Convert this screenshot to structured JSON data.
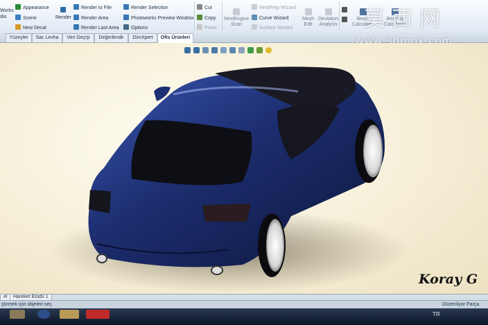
{
  "ribbon": {
    "col1": [
      "Works",
      "dio"
    ],
    "appearance": "Appearance",
    "scene": "Scene",
    "new_decal": "New Decal",
    "render": "Render",
    "render_to_file": "Render to File",
    "render_area": "Render Area",
    "render_last_area": "Render Last Area",
    "render_selection": "Render Selection",
    "photoworks_preview_window": "Photoworks Preview Window",
    "options": "Options",
    "cut": "Cut",
    "copy": "Copy",
    "paste": "Paste",
    "nextengine_scan": [
      "NextEngine",
      "Scan"
    ],
    "nextprep_wizard": "NextPrep Wizard",
    "curve_wizard": "Curve Wizard",
    "surface_wizard": "Surface Wizard",
    "mesh_edit": [
      "Mesh",
      "Edit"
    ],
    "deviation_analysis": [
      "Deviation",
      "Analysis"
    ],
    "beam_calculator": [
      "Beam",
      "Calculator"
    ],
    "bearing_calculator": [
      "Bearing",
      "Calculator"
    ]
  },
  "tabs": [
    "Yüzeyler",
    "Sac Levha",
    "Veri Geçişi",
    "Değerlendir",
    "DimXpert",
    "Ofis Ürünleri"
  ],
  "active_tab": "Ofis Ürünleri",
  "watermark": {
    "chinese": "莫西网",
    "url": "www.3dmox.com"
  },
  "viewport": {
    "signature": "Koray G",
    "car_color": "#1c2d6e",
    "background": "#f6efd7"
  },
  "sheet_tabs": [
    "el",
    "Hareket Etüdü 1"
  ],
  "status": {
    "left": "ştırmek için objeleri seç",
    "right": "Düzenliyor Parça"
  },
  "taskbar": {
    "lang": "TR"
  }
}
